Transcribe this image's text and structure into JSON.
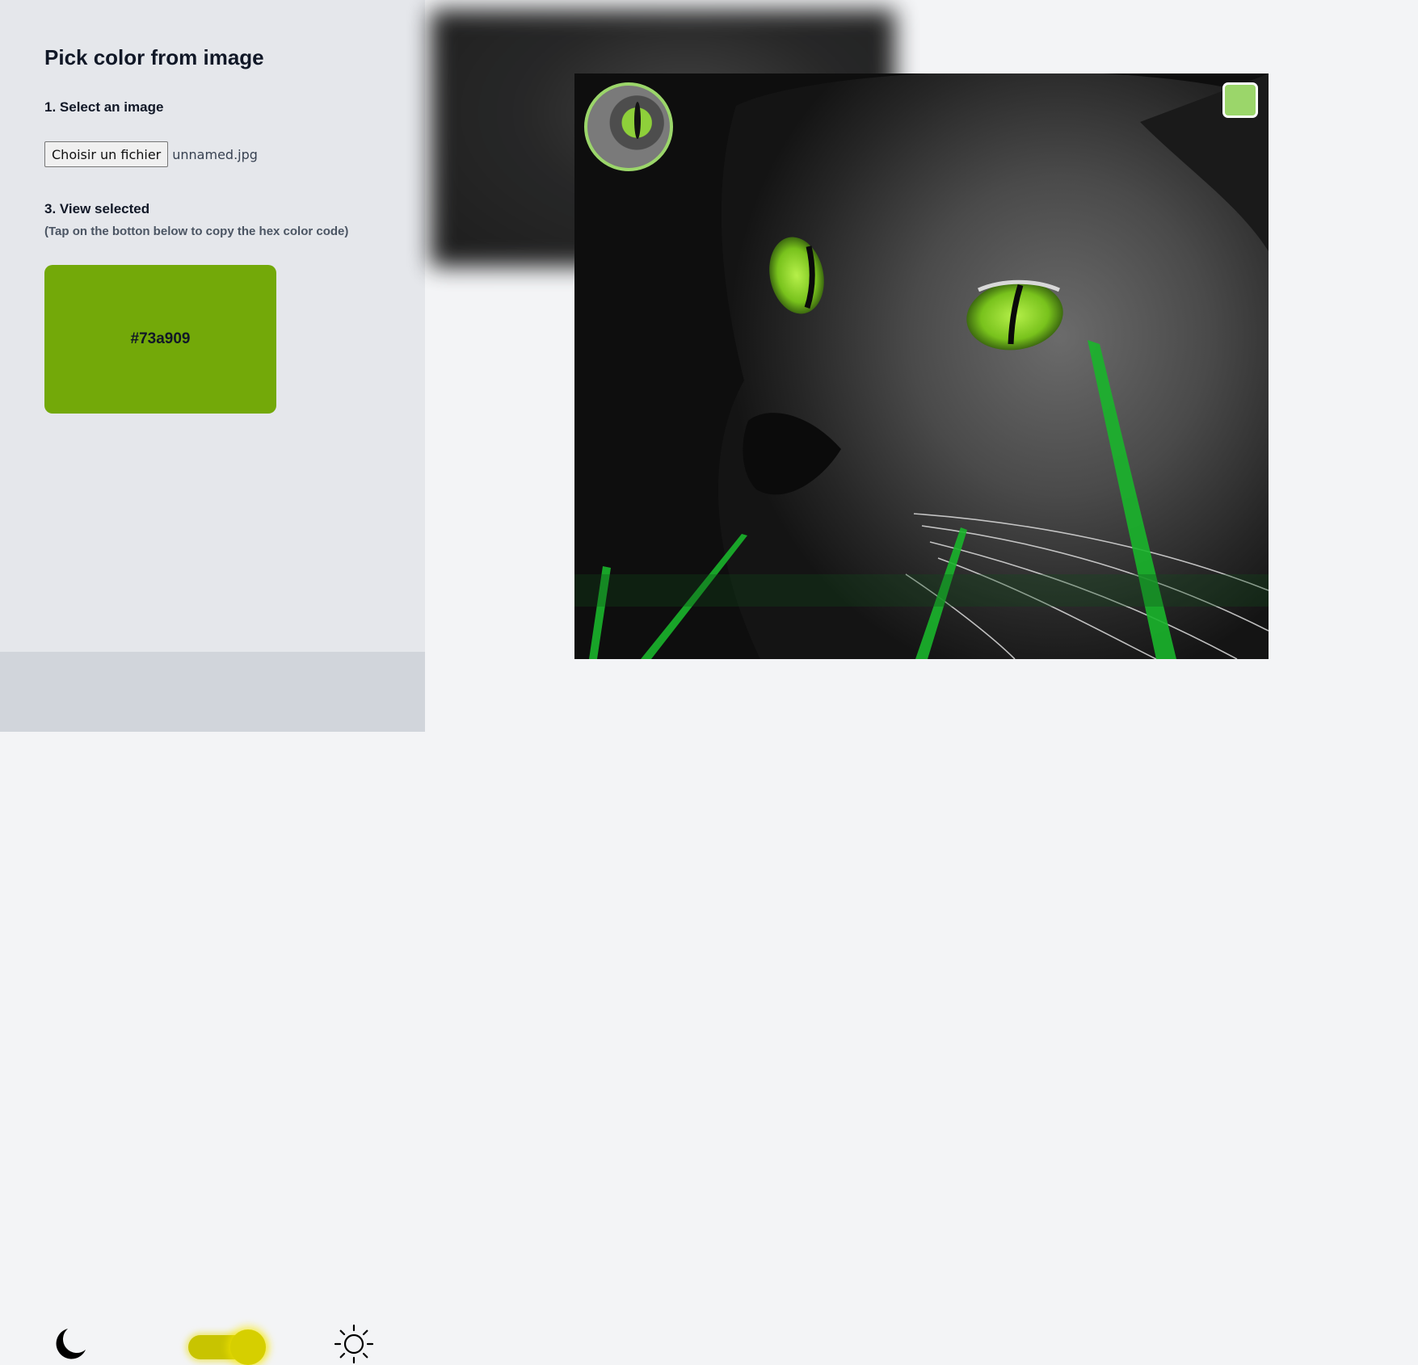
{
  "sidebar": {
    "title": "Pick color from image",
    "step1_label": "1. Select an image",
    "file_button_label": "Choisir un fichier",
    "file_name": "unnamed.jpg",
    "step3_label": "3. View selected",
    "hint": "(Tap on the botton below to copy the hex color code)",
    "selected_hex": "#73a909"
  },
  "footer": {
    "dark_icon": "moon-icon",
    "light_icon": "sun-icon",
    "theme_toggle_on": true,
    "toggle_color": "#c8c400"
  },
  "viewer": {
    "magnifier_border_color": "#9bd66a",
    "hover_color": "#9bd66a"
  },
  "colors": {
    "sidebar_bg": "#e5e7eb",
    "footer_bg": "#d1d5db",
    "page_bg": "#f3f4f6"
  }
}
